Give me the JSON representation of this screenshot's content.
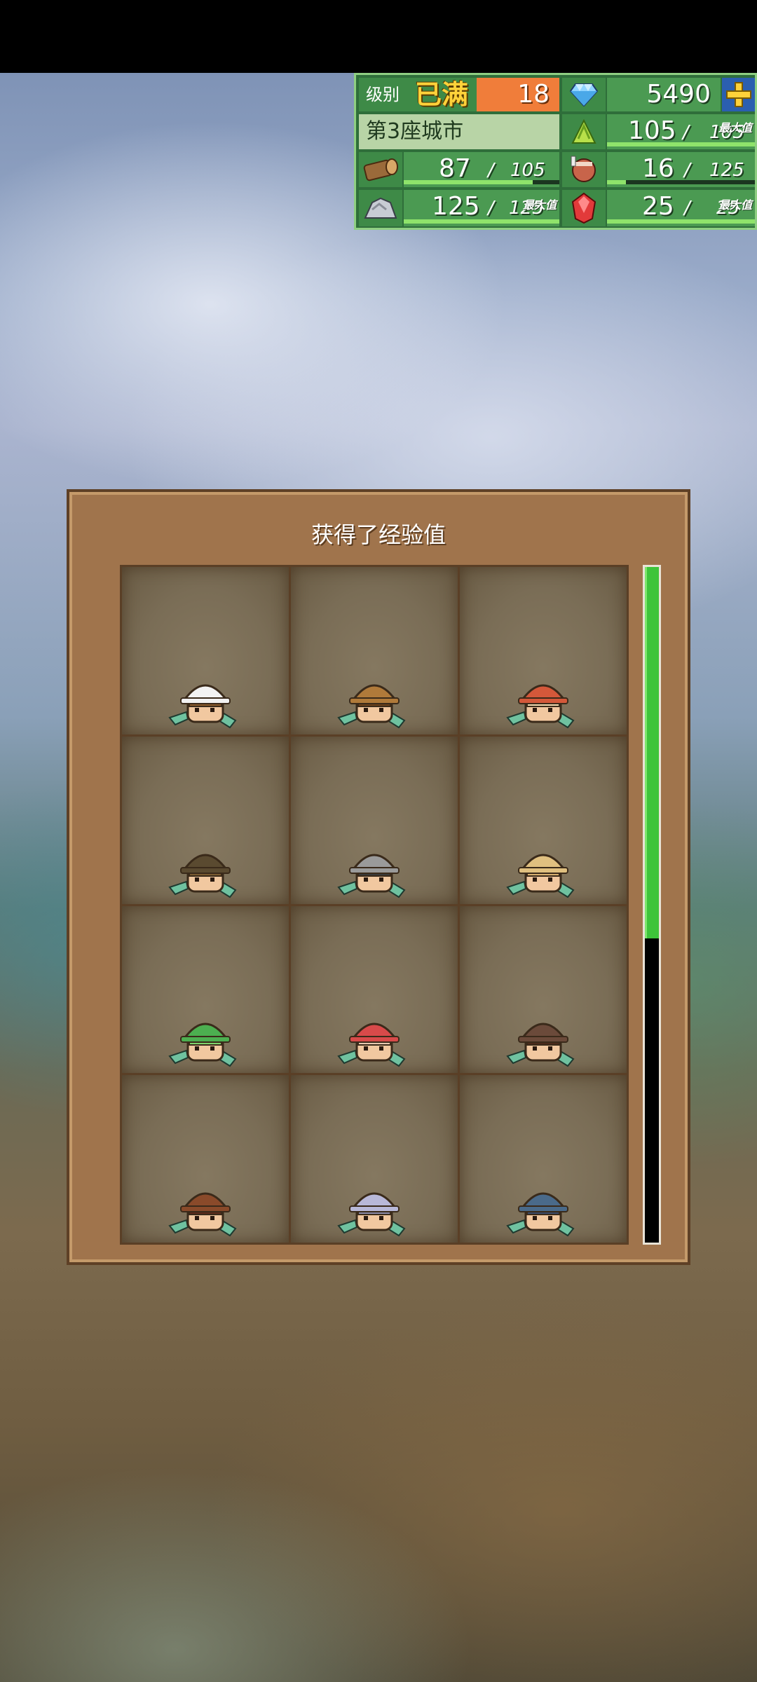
{
  "hud": {
    "level_label": "级别",
    "maxed_label": "已满",
    "level": "18",
    "gems": "5490",
    "city": "第3座城市",
    "max_tag": "最大值",
    "resources": {
      "crop": {
        "current": "105",
        "max": "105",
        "fill": 1.0
      },
      "wood": {
        "current": "87",
        "max": "105",
        "fill": 0.83
      },
      "meat": {
        "current": "16",
        "max": "125",
        "fill": 0.13
      },
      "ore": {
        "current": "125",
        "max": "125",
        "fill": 1.0
      },
      "ruby": {
        "current": "25",
        "max": "25",
        "fill": 1.0
      }
    },
    "colors": {
      "panel_green": "#2f6e3a",
      "level_orange": "#f07d3a",
      "add_blue": "#2b5fb0"
    }
  },
  "dialog": {
    "title": "获得了经验值",
    "heroes": [
      {
        "name": "chef",
        "hat": "#f2f2f2",
        "hair": "#8a5a2b"
      },
      {
        "name": "adventurer",
        "hat": "#b07a3a",
        "hair": "#6a3f1a"
      },
      {
        "name": "orange-cap",
        "hat": "#d4583a",
        "hair": "#f1d9b0"
      },
      {
        "name": "green-band",
        "hat": "#5a4a30",
        "hair": "#7a5a30"
      },
      {
        "name": "steel-helmet",
        "hat": "#9a9a9a",
        "hair": "#3a3a3a"
      },
      {
        "name": "blond-cap",
        "hat": "#e0c080",
        "hair": "#d8b070"
      },
      {
        "name": "green-hair",
        "hat": "#4caf50",
        "hair": "#7ed36b"
      },
      {
        "name": "red-helmet",
        "hat": "#d84a4a",
        "hair": "#e8c8b0"
      },
      {
        "name": "cowboy",
        "hat": "#6b4a3a",
        "hair": "#4a2a1a"
      },
      {
        "name": "brown-cap",
        "hat": "#8a4a2a",
        "hair": "#5a2a1a"
      },
      {
        "name": "silver-helmet",
        "hat": "#b8b8d8",
        "hair": "#8a8aa8"
      },
      {
        "name": "blue-cap",
        "hat": "#4a6a8a",
        "hair": "#3a4a6a"
      }
    ],
    "scroll_fill": 0.45
  }
}
